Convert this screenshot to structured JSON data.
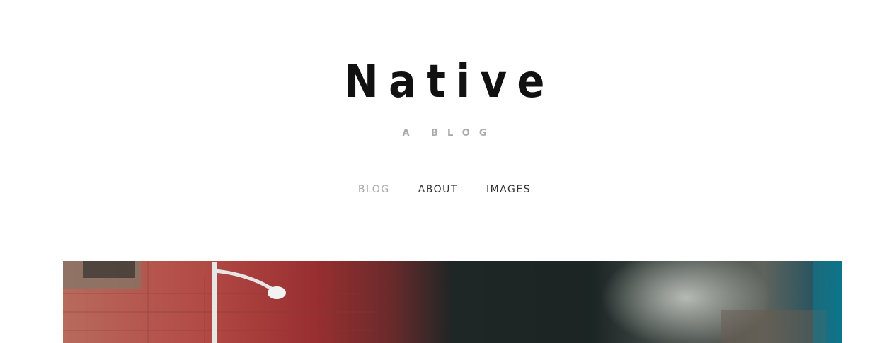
{
  "site": {
    "title": "Native",
    "tagline": "A BLOG"
  },
  "nav": {
    "items": [
      {
        "label": "BLOG",
        "active": true
      },
      {
        "label": "ABOUT",
        "active": false
      },
      {
        "label": "IMAGES",
        "active": false
      }
    ]
  },
  "colors": {
    "title": "#111111",
    "tagline": "#aaaaaa",
    "nav_active": "#aaaaaa",
    "nav_default": "#333333"
  },
  "hero": {
    "image": "street-photo"
  }
}
